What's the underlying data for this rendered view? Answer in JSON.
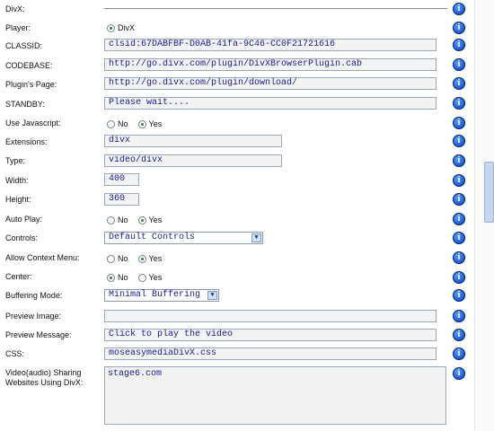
{
  "rows": {
    "divx": {
      "label": "DivX:"
    },
    "player": {
      "label": "Player:",
      "option": "DivX"
    },
    "classid": {
      "label": "CLASSID:",
      "value": "clsid:67DABFBF-D0AB-41fa-9C46-CC0F21721616"
    },
    "codebase": {
      "label": "CODEBASE:",
      "value": "http://go.divx.com/plugin/DivXBrowserPlugin.cab"
    },
    "plugins_page": {
      "label": "Plugin's Page:",
      "value": "http://go.divx.com/plugin/download/"
    },
    "standby": {
      "label": "STANDBY:",
      "value": "Please wait...."
    },
    "use_javascript": {
      "label": "Use Javascript:",
      "no": "No",
      "yes": "Yes"
    },
    "extensions": {
      "label": "Extensions:",
      "value": "divx"
    },
    "type": {
      "label": "Type:",
      "value": "video/divx"
    },
    "width": {
      "label": "Width:",
      "value": "400"
    },
    "height": {
      "label": "Height:",
      "value": "360"
    },
    "auto_play": {
      "label": "Auto Play:",
      "no": "No",
      "yes": "Yes"
    },
    "controls": {
      "label": "Controls:",
      "selected": "Default Controls"
    },
    "allow_context_menu": {
      "label": "Allow Context Menu:",
      "no": "No",
      "yes": "Yes"
    },
    "center": {
      "label": "Center:",
      "no": "No",
      "yes": "Yes"
    },
    "buffering_mode": {
      "label": "Buffering Mode:",
      "selected": "Minimal Buffering"
    },
    "preview_image": {
      "label": "Preview Image:",
      "value": ""
    },
    "preview_message": {
      "label": "Preview Message:",
      "value": "Click to play the video"
    },
    "css": {
      "label": "CSS:",
      "value": "moseasymediaDivX.css"
    },
    "sharing": {
      "label": "Video(audio) Sharing Websites Using DivX:",
      "value": "stage6.com"
    }
  },
  "info_icon_glyph": "i",
  "select_arrow_glyph": "▼"
}
